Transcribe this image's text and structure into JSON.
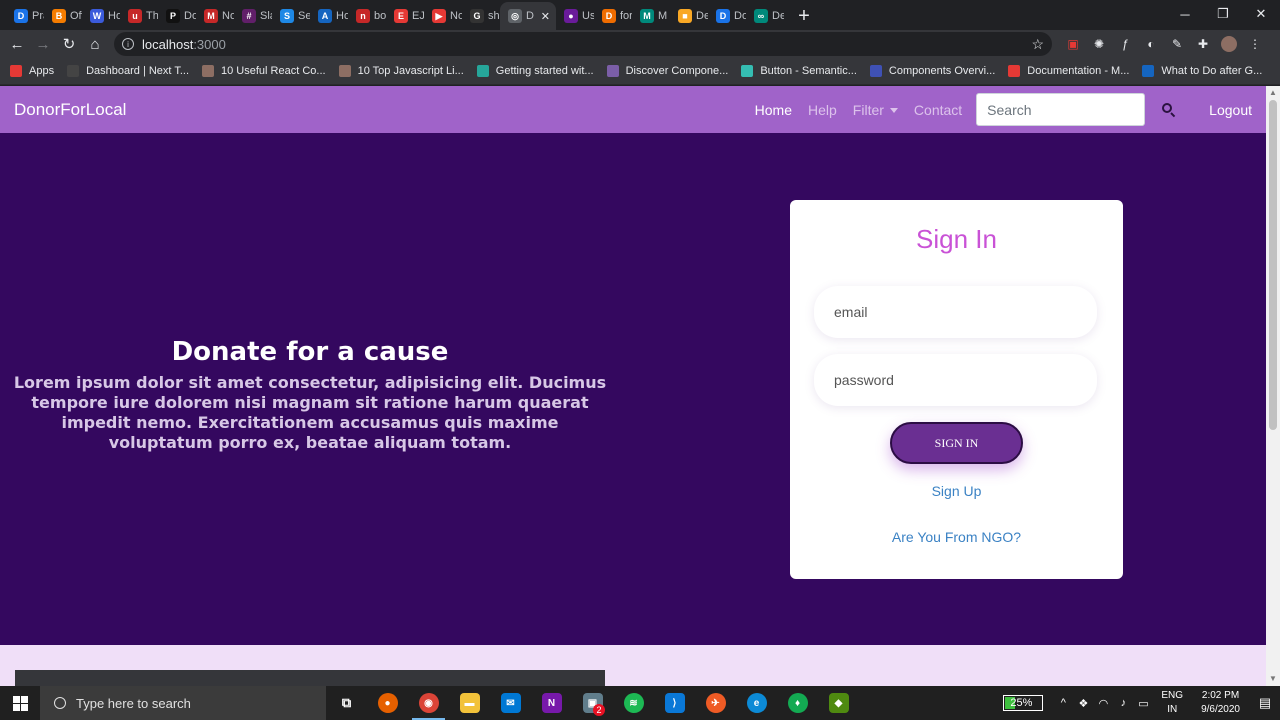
{
  "browser": {
    "tabs": [
      {
        "label": "Pradi",
        "icon": "D",
        "color": "#1a73e8"
      },
      {
        "label": "Offic",
        "icon": "B",
        "color": "#f57c00"
      },
      {
        "label": "How",
        "icon": "W",
        "color": "#3b5bdb"
      },
      {
        "label": "The (",
        "icon": "u",
        "color": "#c62828"
      },
      {
        "label": "Docu",
        "icon": "P",
        "color": "#111111"
      },
      {
        "label": "Node",
        "icon": "M",
        "color": "#c62828"
      },
      {
        "label": "Slack",
        "icon": "#",
        "color": "#611f69"
      },
      {
        "label": "Send",
        "icon": "S",
        "color": "#1e88e5"
      },
      {
        "label": "Hom",
        "icon": "A",
        "color": "#1565c0"
      },
      {
        "label": "body",
        "icon": "n",
        "color": "#c62828"
      },
      {
        "label": "EJS -",
        "icon": "E",
        "color": "#e53935"
      },
      {
        "label": "Node",
        "icon": "▶",
        "color": "#e53935"
      },
      {
        "label": "shru",
        "icon": "G",
        "color": "#333333"
      },
      {
        "label": "D",
        "icon": "◎",
        "color": "#5f6368",
        "active": true
      },
      {
        "label": "Use",
        "icon": "●",
        "color": "#6a1b9a"
      },
      {
        "label": "forea",
        "icon": "D",
        "color": "#ef6c00"
      },
      {
        "label": "M",
        "icon": "M",
        "color": "#00897b"
      },
      {
        "label": "Delh",
        "icon": "■",
        "color": "#f9a825"
      },
      {
        "label": "Dono",
        "icon": "D",
        "color": "#1a73e8"
      },
      {
        "label": "Delh",
        "icon": "∞",
        "color": "#00897b"
      }
    ],
    "tab_close": "✕",
    "new_tab": "+",
    "url_host": "localhost",
    "url_port": ":3000",
    "bookmarks": [
      {
        "label": "Apps",
        "color": "#e53935"
      },
      {
        "label": "Dashboard | Next T...",
        "color": "#444444"
      },
      {
        "label": "10 Useful React Co...",
        "color": "#8d6e63"
      },
      {
        "label": "10 Top Javascript Li...",
        "color": "#8d6e63"
      },
      {
        "label": "Getting started wit...",
        "color": "#26a69a"
      },
      {
        "label": "Discover Compone...",
        "color": "#7b5ea7"
      },
      {
        "label": "Button - Semantic...",
        "color": "#35bdb2"
      },
      {
        "label": "Components Overvi...",
        "color": "#3f51b5"
      },
      {
        "label": "Documentation - M...",
        "color": "#e53935"
      },
      {
        "label": "What to Do after G...",
        "color": "#1565c0"
      }
    ]
  },
  "page": {
    "brand": "DonorForLocal",
    "nav": {
      "home": "Home",
      "help": "Help",
      "filter": "Filter",
      "contact": "Contact",
      "search_placeholder": "Search",
      "logout": "Logout"
    },
    "hero": {
      "title": "Donate for a cause",
      "body": "Lorem ipsum dolor sit amet consectetur, adipisicing elit. Ducimus tempore iure dolorem nisi magnam sit ratione harum quaerat impedit nemo. Exercitationem accusamus quis maxime voluptatum porro ex, beatae aliquam totam."
    },
    "signin": {
      "title": "Sign In",
      "email_placeholder": "email",
      "password_placeholder": "password",
      "button": "SIGN IN",
      "signup": "Sign Up",
      "ngo": "Are You From NGO?"
    },
    "colors": {
      "navbar": "#a063c9",
      "hero_bg": "#34085f",
      "title_accent": "#c952d6",
      "button": "#6a2f92",
      "link": "#3b82c4"
    }
  },
  "taskbar": {
    "search_placeholder": "Type here to search",
    "battery": "25%",
    "battery_level": 0.25,
    "language": "ENG",
    "region": "IN",
    "time": "2:02 PM",
    "date": "9/6/2020",
    "onenote_badge": "2"
  }
}
